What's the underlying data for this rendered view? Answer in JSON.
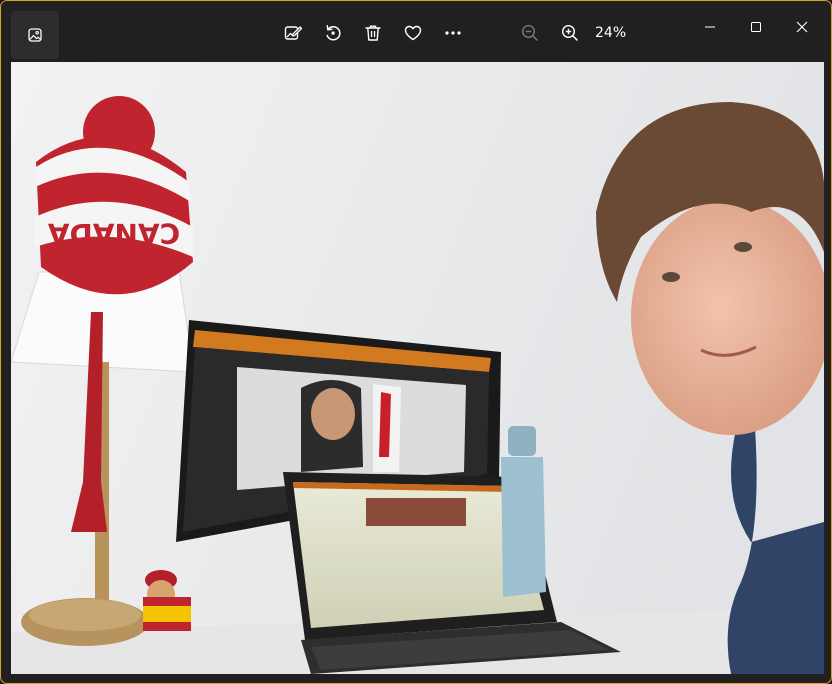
{
  "toolbar": {
    "app_icon": "photo-gallery-icon",
    "buttons": [
      {
        "name": "edit-image",
        "icon": "edit-image-icon"
      },
      {
        "name": "rotate",
        "icon": "rotate-icon"
      },
      {
        "name": "delete",
        "icon": "trash-icon"
      },
      {
        "name": "favorite",
        "icon": "heart-icon"
      },
      {
        "name": "more",
        "icon": "more-icon"
      },
      {
        "name": "zoom-out",
        "icon": "zoom-out-icon"
      },
      {
        "name": "zoom-in",
        "icon": "zoom-in-icon"
      }
    ],
    "zoom_level": "24%"
  },
  "window_controls": {
    "minimize_icon": "minimize-icon",
    "maximize_icon": "maximize-icon",
    "close_icon": "close-icon"
  },
  "photo": {
    "hat_text": "CANADA",
    "colors": {
      "accent_border": "#d9a02a",
      "titlebar_bg": "#202020",
      "wall": "#ebecee",
      "hat_red": "#c0242e"
    }
  }
}
